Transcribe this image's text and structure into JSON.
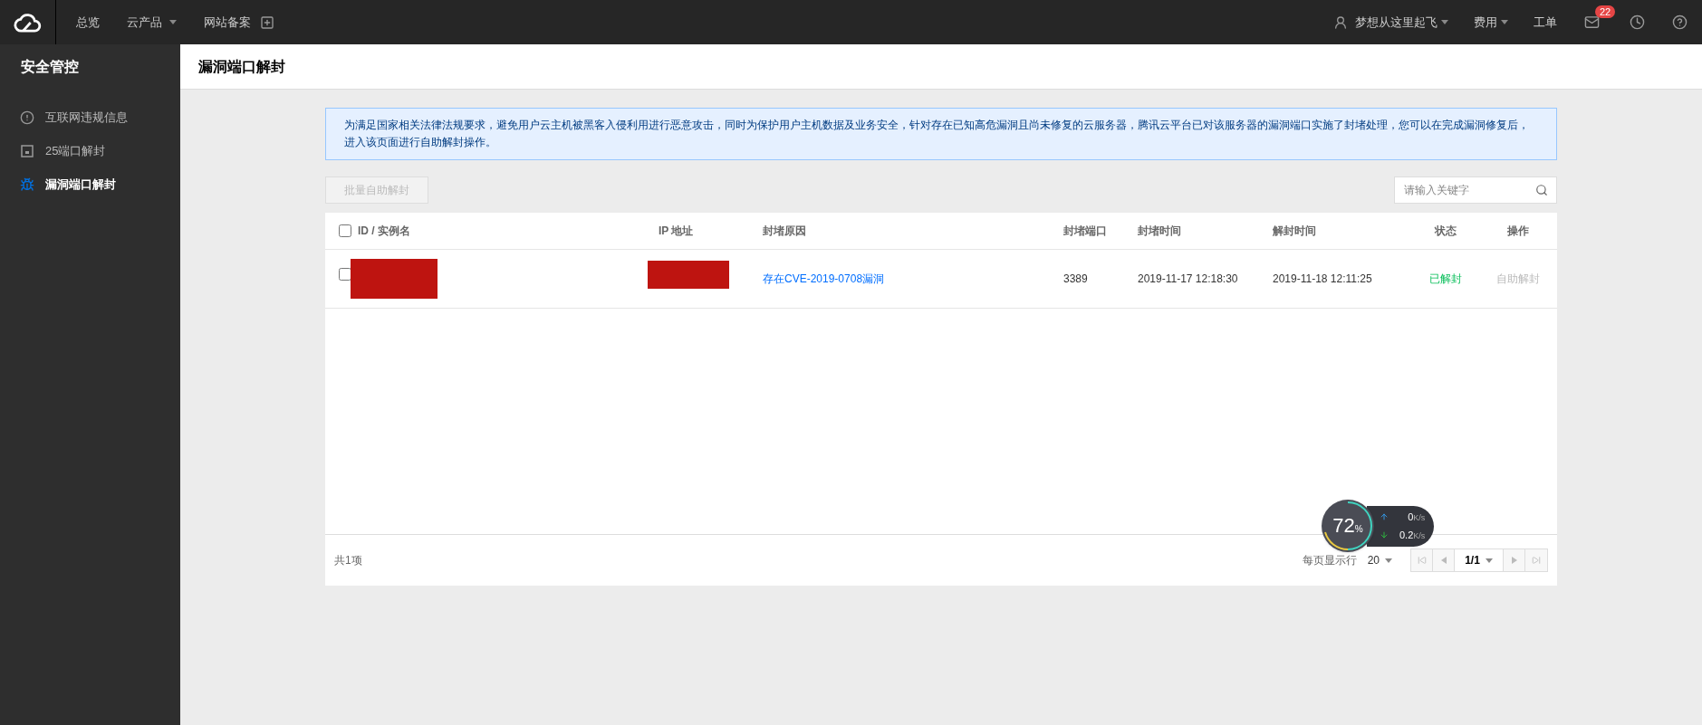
{
  "topbar": {
    "nav": [
      {
        "label": "总览",
        "dropdown": false
      },
      {
        "label": "云产品",
        "dropdown": true
      },
      {
        "label": "网站备案",
        "dropdown": false
      }
    ],
    "user": "梦想从这里起飞",
    "billing": "费用",
    "tickets": "工单",
    "mail_count": "22"
  },
  "sidebar": {
    "title": "安全管控",
    "items": [
      {
        "label": "互联网违规信息",
        "kind": "alert",
        "selected": false
      },
      {
        "label": "25端口解封",
        "kind": "port",
        "selected": false
      },
      {
        "label": "漏洞端口解封",
        "kind": "bug",
        "selected": true
      }
    ]
  },
  "page_title": "漏洞端口解封",
  "notice": "为满足国家相关法律法规要求，避免用户云主机被黑客入侵利用进行恶意攻击，同时为保护用户主机数据及业务安全，针对存在已知高危漏洞且尚未修复的云服务器，腾讯云平台已对该服务器的漏洞端口实施了封堵处理，您可以在完成漏洞修复后，进入该页面进行自助解封操作。",
  "batch_button": {
    "label": "批量自助解封",
    "disabled": true
  },
  "search": {
    "placeholder": "请输入关键字"
  },
  "table": {
    "columns": [
      "ID / 实例名",
      "IP 地址",
      "封堵原因",
      "封堵端口",
      "封堵时间",
      "解封时间",
      "状态",
      "操作"
    ],
    "all_checked": false,
    "rows": [
      {
        "checked": false,
        "reason": "存在CVE-2019-0708漏洞",
        "port": "3389",
        "blocked_at": "2019-11-17 12:18:30",
        "unblocked_at": "2019-11-18 12:11:25",
        "status": "已解封",
        "action": "自助解封",
        "action_disabled": true
      }
    ]
  },
  "footer": {
    "total": "共1项",
    "per_page_label": "每页显示行",
    "per_page": "20",
    "page": "1/1"
  },
  "speed_widget": {
    "percent": "72",
    "unit": "%",
    "up": "0",
    "up_unit": "K/s",
    "down": "0.2",
    "down_unit": "K/s"
  }
}
